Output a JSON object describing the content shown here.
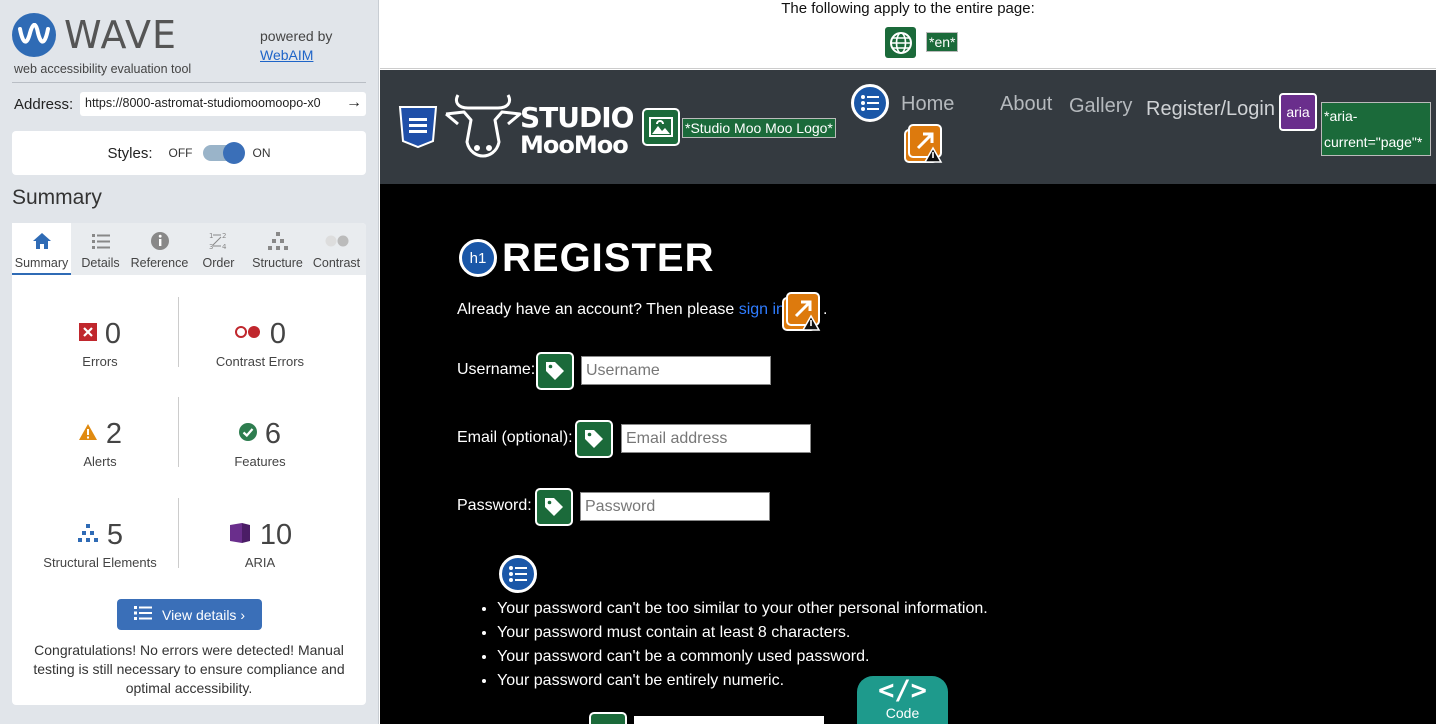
{
  "sidebar": {
    "app_name": "WAVE",
    "tagline": "web accessibility evaluation tool",
    "powered_by": "powered by",
    "powered_link": "WebAIM",
    "address_label": "Address:",
    "address_value": "https://8000-astromat-studiomoomoopo-x0",
    "styles_label": "Styles:",
    "styles_off": "OFF",
    "styles_on": "ON",
    "summary_heading": "Summary",
    "tabs": [
      {
        "label": "Summary",
        "icon": "home-icon"
      },
      {
        "label": "Details",
        "icon": "list-icon"
      },
      {
        "label": "Reference",
        "icon": "info-icon"
      },
      {
        "label": "Order",
        "icon": "order-icon"
      },
      {
        "label": "Structure",
        "icon": "hierarchy-icon"
      },
      {
        "label": "Contrast",
        "icon": "contrast-icon"
      }
    ],
    "stats": {
      "errors": {
        "count": "0",
        "label": "Errors"
      },
      "contrast_errors": {
        "count": "0",
        "label": "Contrast Errors"
      },
      "alerts": {
        "count": "2",
        "label": "Alerts"
      },
      "features": {
        "count": "6",
        "label": "Features"
      },
      "structural": {
        "count": "5",
        "label": "Structural Elements"
      },
      "aria": {
        "count": "10",
        "label": "ARIA"
      }
    },
    "view_details": "View details ›",
    "congrats": "Congratulations! No errors were detected! Manual testing is still necessary to ensure compliance and optimal accessibility."
  },
  "page": {
    "apply_text": "The following apply to the entire page:",
    "lang_tag": "*en*",
    "logo_line1": "STUDIO",
    "logo_line2": "MooMoo",
    "logo_alt_tag": "*Studio Moo Moo Logo*",
    "nav": {
      "home": "Home",
      "about": "About",
      "gallery": "Gallery",
      "register": "Register/Login",
      "aria_badge": "aria",
      "aria_tag": "*aria-current=\"page\"*"
    },
    "h1_badge": "h1",
    "title": "REGISTER",
    "already_text": "Already have an account? Then please ",
    "sign_in": "sign in",
    "period": ".",
    "username_label": "Username:",
    "username_placeholder": "Username",
    "email_label": "Email (optional):",
    "email_placeholder": "Email address",
    "password_label": "Password:",
    "password_placeholder": "Password",
    "password_rules": [
      "Your password can't be too similar to your other personal information.",
      "Your password must contain at least 8 characters.",
      "Your password can't be a commonly used password.",
      "Your password can't be entirely numeric."
    ],
    "code_glyph": "</>",
    "code_label": "Code"
  },
  "colors": {
    "wave_blue": "#2f6bb5",
    "feature_green": "#1b6a3a",
    "alert_orange": "#dd7a0d",
    "aria_purple": "#6a2e8c",
    "navbar_bg": "#343a40",
    "code_teal": "#1e9a8c"
  }
}
